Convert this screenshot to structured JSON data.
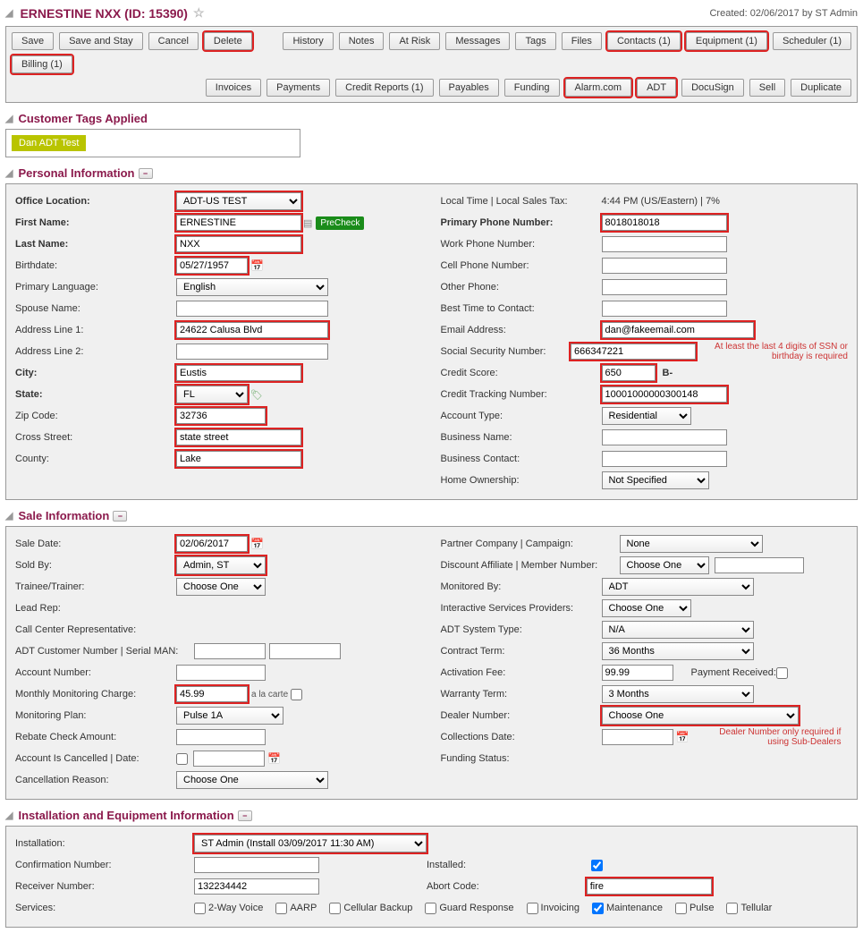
{
  "header": {
    "title": "ERNESTINE NXX (ID: 15390)",
    "created": "Created: 02/06/2017 by ST Admin"
  },
  "toolbar": {
    "row1_left": [
      "Save",
      "Save and Stay",
      "Cancel",
      "Delete"
    ],
    "row1_right": [
      "History",
      "Notes",
      "At Risk",
      "Messages",
      "Tags",
      "Files",
      "Contacts (1)",
      "Equipment (1)",
      "Scheduler (1)",
      "Billing (1)"
    ],
    "row2": [
      "Invoices",
      "Payments",
      "Credit Reports (1)",
      "Payables",
      "Funding",
      "Alarm.com",
      "ADT",
      "DocuSign",
      "Sell",
      "Duplicate"
    ],
    "hl1": [
      "Delete",
      "Contacts (1)",
      "Equipment (1)",
      "Billing (1)"
    ],
    "hl2": [
      "Alarm.com",
      "ADT"
    ]
  },
  "tags": {
    "title": "Customer Tags Applied",
    "items": [
      "Dan ADT Test"
    ]
  },
  "pi": {
    "title": "Personal Information",
    "office_label": "Office Location:",
    "office": "ADT-US TEST",
    "first_label": "First Name:",
    "first": "ERNESTINE",
    "precheck": "PreCheck",
    "last_label": "Last Name:",
    "last": "NXX",
    "bday_label": "Birthdate:",
    "bday": "05/27/1957",
    "lang_label": "Primary Language:",
    "lang": "English",
    "spouse_label": "Spouse Name:",
    "spouse": "",
    "addr1_label": "Address Line 1:",
    "addr1": "24622 Calusa Blvd",
    "addr2_label": "Address Line 2:",
    "addr2": "",
    "city_label": "City:",
    "city": "Eustis",
    "state_label": "State:",
    "state": "FL",
    "zip_label": "Zip Code:",
    "zip": "32736",
    "cross_label": "Cross Street:",
    "cross": "state street",
    "county_label": "County:",
    "county": "Lake",
    "time_label": "Local Time | Local Sales Tax:",
    "time_val": "4:44 PM (US/Eastern) | 7%",
    "pphone_label": "Primary Phone Number:",
    "pphone": "8018018018",
    "wphone_label": "Work Phone Number:",
    "wphone": "",
    "cphone_label": "Cell Phone Number:",
    "cphone": "",
    "ophone_label": "Other Phone:",
    "ophone": "",
    "btc_label": "Best Time to Contact:",
    "btc": "",
    "email_label": "Email Address:",
    "email": "dan@fakeemail.com",
    "ssn_label": "Social Security Number:",
    "ssn": "666347221",
    "ssn_note": "At least the last 4 digits of SSN or birthday is required",
    "cscore_label": "Credit Score:",
    "cscore": "650",
    "cgrade": "B-",
    "ctrack_label": "Credit Tracking Number:",
    "ctrack": "10001000000300148",
    "atype_label": "Account Type:",
    "atype": "Residential",
    "bname_label": "Business Name:",
    "bname": "",
    "bcontact_label": "Business Contact:",
    "bcontact": "",
    "home_label": "Home Ownership:",
    "home": "Not Specified"
  },
  "si": {
    "title": "Sale Information",
    "sdate_label": "Sale Date:",
    "sdate": "02/06/2017",
    "soldby_label": "Sold By:",
    "soldby": "Admin, ST",
    "trainee_label": "Trainee/Trainer:",
    "trainee": "Choose One",
    "lead_label": "Lead Rep:",
    "ccr_label": "Call Center Representative:",
    "adtcust_label": "ADT Customer Number | Serial MAN:",
    "adtcust1": "",
    "adtcust2": "",
    "acct_label": "Account Number:",
    "acct": "",
    "mmc_label": "Monthly Monitoring Charge:",
    "mmc": "45.99",
    "alacartelabel": "a la carte",
    "mplan_label": "Monitoring Plan:",
    "mplan": "Pulse 1A",
    "rebate_label": "Rebate Check Amount:",
    "rebate": "",
    "cancel_label": "Account Is Cancelled | Date:",
    "cancel_date": "",
    "creason_label": "Cancellation Reason:",
    "creason": "Choose One",
    "partner_label": "Partner Company | Campaign:",
    "partner": "None",
    "disc_label": "Discount Affiliate | Member Number:",
    "disc": "Choose One",
    "disc_num": "",
    "mon_label": "Monitored By:",
    "mon": "ADT",
    "isp_label": "Interactive Services Providers:",
    "isp": "Choose One",
    "systype_label": "ADT System Type:",
    "systype": "N/A",
    "cterm_label": "Contract Term:",
    "cterm": "36 Months",
    "afee_label": "Activation Fee:",
    "afee": "99.99",
    "prec_label": "Payment Received:",
    "wterm_label": "Warranty Term:",
    "wterm": "3 Months",
    "dealer_label": "Dealer Number:",
    "dealer": "Choose One",
    "dealer_note": "Dealer Number only required if using Sub-Dealers",
    "coll_label": "Collections Date:",
    "coll": "",
    "fstat_label": "Funding Status:"
  },
  "ie": {
    "title": "Installation and Equipment Information",
    "inst_label": "Installation:",
    "inst": "ST Admin (Install 03/09/2017 11:30 AM)",
    "conf_label": "Confirmation Number:",
    "conf": "",
    "installed_label": "Installed:",
    "rec_label": "Receiver Number:",
    "rec": "132234442",
    "abort_label": "Abort Code:",
    "abort": "fire",
    "svc_label": "Services:",
    "services": [
      "2-Way Voice",
      "AARP",
      "Cellular Backup",
      "Guard Response",
      "Invoicing",
      "Maintenance",
      "Pulse",
      "Tellular"
    ],
    "svc_checked": [
      "Maintenance"
    ]
  }
}
